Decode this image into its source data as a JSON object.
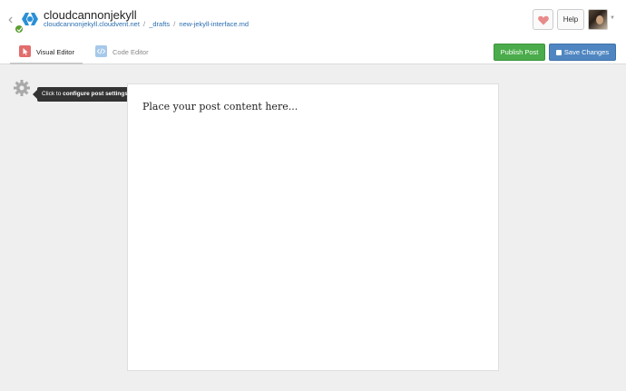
{
  "header": {
    "site_title": "cloudcannonjekyll",
    "breadcrumb": {
      "domain": "cloudcannonjekyll.cloudvent.net",
      "separator": "/",
      "folder": "_drafts",
      "file": "new-jekyll-interface.md"
    },
    "help_label": "Help"
  },
  "tabs": [
    {
      "label": "Visual Editor",
      "active": true,
      "icon": "cursor-icon"
    },
    {
      "label": "Code Editor",
      "active": false,
      "icon": "code-icon"
    }
  ],
  "actions": {
    "publish_label": "Publish Post",
    "save_label": "Save Changes"
  },
  "settings": {
    "tooltip_prefix": "Click to",
    "tooltip_bold": "configure post settings"
  },
  "editor": {
    "placeholder": "Place your post content here..."
  },
  "colors": {
    "publish": "#4aac4a",
    "save": "#4f86c1",
    "link": "#2a6db0",
    "heart": "#e98a8a"
  }
}
